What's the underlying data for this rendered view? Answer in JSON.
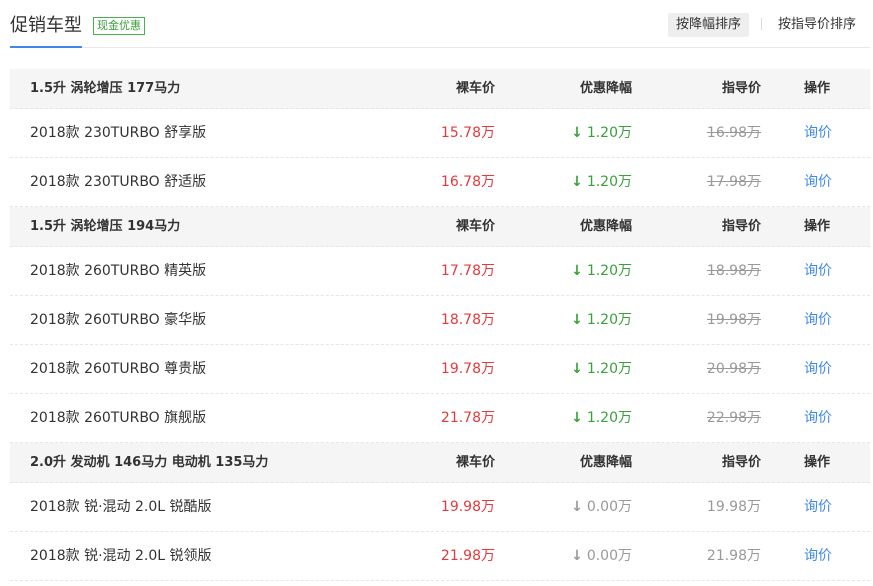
{
  "header": {
    "title": "促销车型",
    "badge": "现金优惠",
    "sort_discount": "按降幅排序",
    "sort_guide": "按指导价排序"
  },
  "colors": {
    "accent": "#3f88e8",
    "price_red": "#e6393d",
    "discount_green": "#3aa03a",
    "muted_grey": "#999999"
  },
  "groups": [
    {
      "name": "1.5升 涡轮增压 177马力",
      "col_price": "裸车价",
      "col_discount": "优惠降幅",
      "col_guide": "指导价",
      "col_action": "操作",
      "items": [
        {
          "name": "2018款 230TURBO 舒享版",
          "price": "15.78万",
          "arrow": "↓",
          "discount": "1.20万",
          "guide": "16.98万",
          "action": "询价"
        },
        {
          "name": "2018款 230TURBO 舒适版",
          "price": "16.78万",
          "arrow": "↓",
          "discount": "1.20万",
          "guide": "17.98万",
          "action": "询价"
        }
      ]
    },
    {
      "name": "1.5升 涡轮增压 194马力",
      "col_price": "裸车价",
      "col_discount": "优惠降幅",
      "col_guide": "指导价",
      "col_action": "操作",
      "items": [
        {
          "name": "2018款 260TURBO 精英版",
          "price": "17.78万",
          "arrow": "↓",
          "discount": "1.20万",
          "guide": "18.98万",
          "action": "询价"
        },
        {
          "name": "2018款 260TURBO 豪华版",
          "price": "18.78万",
          "arrow": "↓",
          "discount": "1.20万",
          "guide": "19.98万",
          "action": "询价"
        },
        {
          "name": "2018款 260TURBO 尊贵版",
          "price": "19.78万",
          "arrow": "↓",
          "discount": "1.20万",
          "guide": "20.98万",
          "action": "询价"
        },
        {
          "name": "2018款 260TURBO 旗舰版",
          "price": "21.78万",
          "arrow": "↓",
          "discount": "1.20万",
          "guide": "22.98万",
          "action": "询价"
        }
      ]
    },
    {
      "name": "2.0升 发动机 146马力 电动机 135马力",
      "col_price": "裸车价",
      "col_discount": "优惠降幅",
      "col_guide": "指导价",
      "col_action": "操作",
      "items": [
        {
          "name": "2018款 锐·混动 2.0L 锐酷版",
          "price": "19.98万",
          "arrow": "↓",
          "discount": "0.00万",
          "guide": "19.98万",
          "action": "询价"
        },
        {
          "name": "2018款 锐·混动 2.0L 锐领版",
          "price": "21.98万",
          "arrow": "↓",
          "discount": "0.00万",
          "guide": "21.98万",
          "action": "询价"
        }
      ]
    }
  ]
}
